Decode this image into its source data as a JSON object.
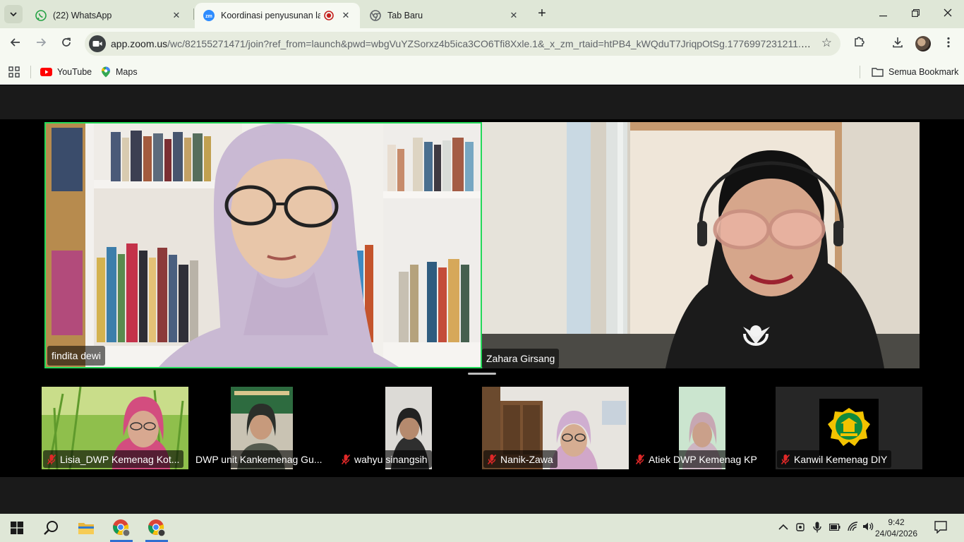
{
  "browser": {
    "tabs": [
      {
        "title": "(22) WhatsApp",
        "icon": "whatsapp-icon"
      },
      {
        "title": "Koordinasi penyusunan lapo",
        "icon": "zoom-icon",
        "recording": true
      },
      {
        "title": "Tab Baru",
        "icon": "chrome-icon"
      }
    ],
    "url_host": "app.zoom.us",
    "url_path": "/wc/82155271471/join?ref_from=launch&pwd=wbgVuYZSorxz4b5ica3CO6Tfi8Xxle.1&_x_zm_rtaid=htPB4_kWQduT7JriqpOtSg.1776997231211.816...",
    "bookmarks": [
      {
        "label": "YouTube",
        "icon": "youtube-icon"
      },
      {
        "label": "Maps",
        "icon": "maps-icon"
      }
    ],
    "all_bookmarks_label": "Semua Bookmark"
  },
  "meeting": {
    "active_speaker_color": "#23d959",
    "main": [
      {
        "name": "findita dewi",
        "active": true
      },
      {
        "name": "Zahara Girsang",
        "active": false
      }
    ],
    "thumbnails": [
      {
        "name": "Lisia_DWP Kemenag Kot...",
        "muted": true
      },
      {
        "name": "DWP unit Kankemenag Gu...",
        "muted": false
      },
      {
        "name": "wahyu sinangsih",
        "muted": true
      },
      {
        "name": "Nanik-Zawa",
        "muted": true
      },
      {
        "name": "Atiek DWP Kemenag KP",
        "muted": true
      },
      {
        "name": "Kanwil Kemenag DIY",
        "muted": true
      }
    ]
  },
  "taskbar": {
    "time": "9:42",
    "date": "24/04/2026"
  }
}
